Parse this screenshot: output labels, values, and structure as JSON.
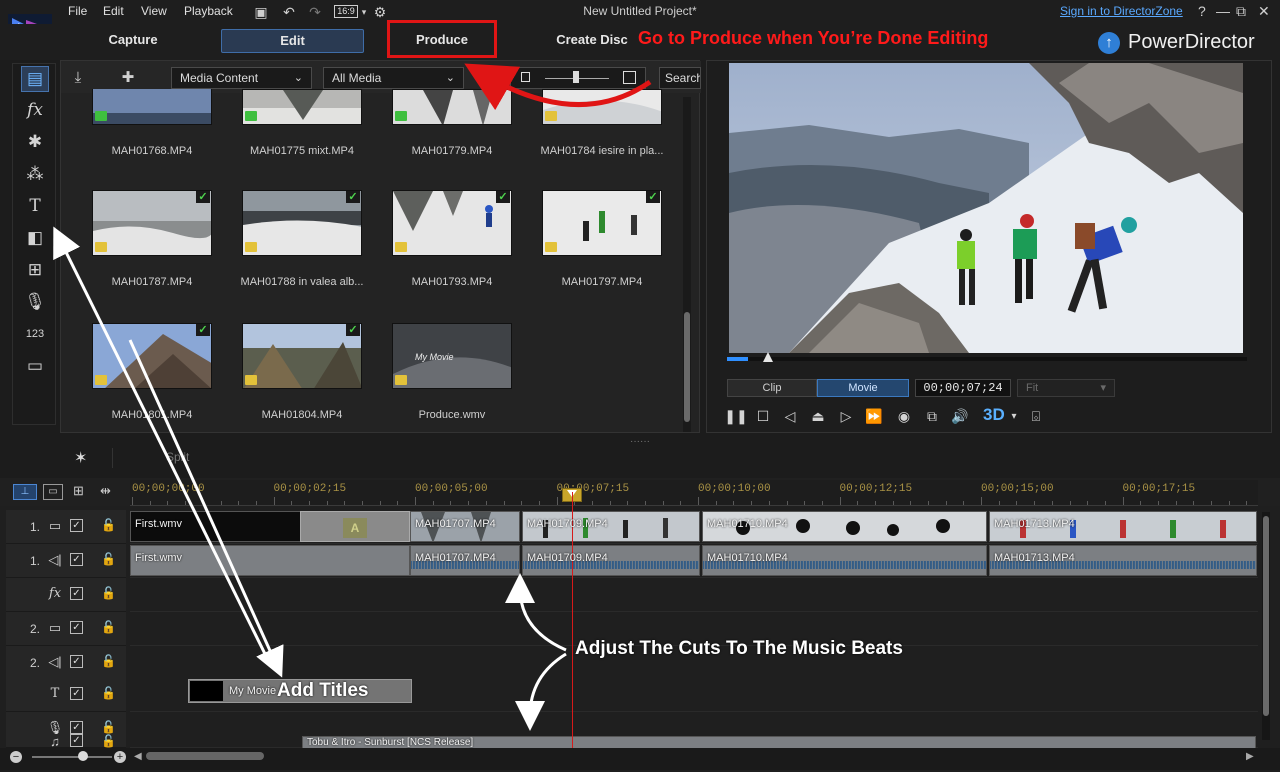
{
  "menu": [
    "File",
    "Edit",
    "View",
    "Playback"
  ],
  "aspect_ratio": "16:9",
  "window_title": "New Untitled Project*",
  "sign_in": "Sign in to DirectorZone",
  "modes": {
    "capture": "Capture",
    "edit": "Edit",
    "produce": "Produce",
    "create_disc": "Create Disc"
  },
  "brand": "PowerDirector",
  "annotations": {
    "produce": "Go to Produce when You’re Done Editing",
    "cuts": "Adjust The Cuts To The Music Beats",
    "titles": "Add Titles"
  },
  "library": {
    "content_filter": "Media Content",
    "media_filter": "All Media",
    "search_placeholder": "Search",
    "items": [
      {
        "name": "MAH01768.MP4",
        "type": "video",
        "used": false
      },
      {
        "name": "MAH01775 mixt.MP4",
        "type": "video",
        "used": false
      },
      {
        "name": "MAH01779.MP4",
        "type": "video",
        "used": false
      },
      {
        "name": "MAH01784 iesire in pla...",
        "type": "audio",
        "used": false
      },
      {
        "name": "MAH01787.MP4",
        "type": "audio",
        "used": true
      },
      {
        "name": "MAH01788 in valea alb...",
        "type": "audio",
        "used": true
      },
      {
        "name": "MAH01793.MP4",
        "type": "audio",
        "used": true
      },
      {
        "name": "MAH01797.MP4",
        "type": "audio",
        "used": true
      },
      {
        "name": "MAH01801.MP4",
        "type": "audio",
        "used": true
      },
      {
        "name": "MAH01804.MP4",
        "type": "audio",
        "used": true
      },
      {
        "name": "Produce.wmv",
        "type": "audio",
        "used": false,
        "overlay_text": "My Movie"
      }
    ]
  },
  "preview": {
    "mode_clip": "Clip",
    "mode_movie": "Movie",
    "timecode": "00;00;07;24",
    "fit": "Fit",
    "threed": "3D",
    "seek_progress_pct": 4
  },
  "mid_toolbar": {
    "split": "Split"
  },
  "timeline": {
    "ticks": [
      "00;00;00;00",
      "00;00;02;15",
      "00;00;05;00",
      "00;00;07;15",
      "00;00;10;00",
      "00;00;12;15",
      "00;00;15;00",
      "00;00;17;15"
    ],
    "tracks": [
      {
        "num": "1.",
        "kind": "video"
      },
      {
        "num": "1.",
        "kind": "audio"
      },
      {
        "num": "",
        "kind": "fx"
      },
      {
        "num": "2.",
        "kind": "video"
      },
      {
        "num": "2.",
        "kind": "audio"
      },
      {
        "num": "",
        "kind": "title"
      },
      {
        "num": "",
        "kind": "voice"
      },
      {
        "num": "",
        "kind": "music"
      }
    ],
    "video_clips": [
      "First.wmv",
      "MAH01707.MP4",
      "MAH01709.MP4",
      "MAH01710.MP4",
      "MAH01713.MP4"
    ],
    "audio_clips": [
      "First.wmv",
      "MAH01707.MP4",
      "MAH01709.MP4",
      "MAH01710.MP4",
      "MAH01713.MP4"
    ],
    "title_clip": "My Movie",
    "music_clip": "Tobu & Itro - Sunburst [NCS Release]"
  }
}
